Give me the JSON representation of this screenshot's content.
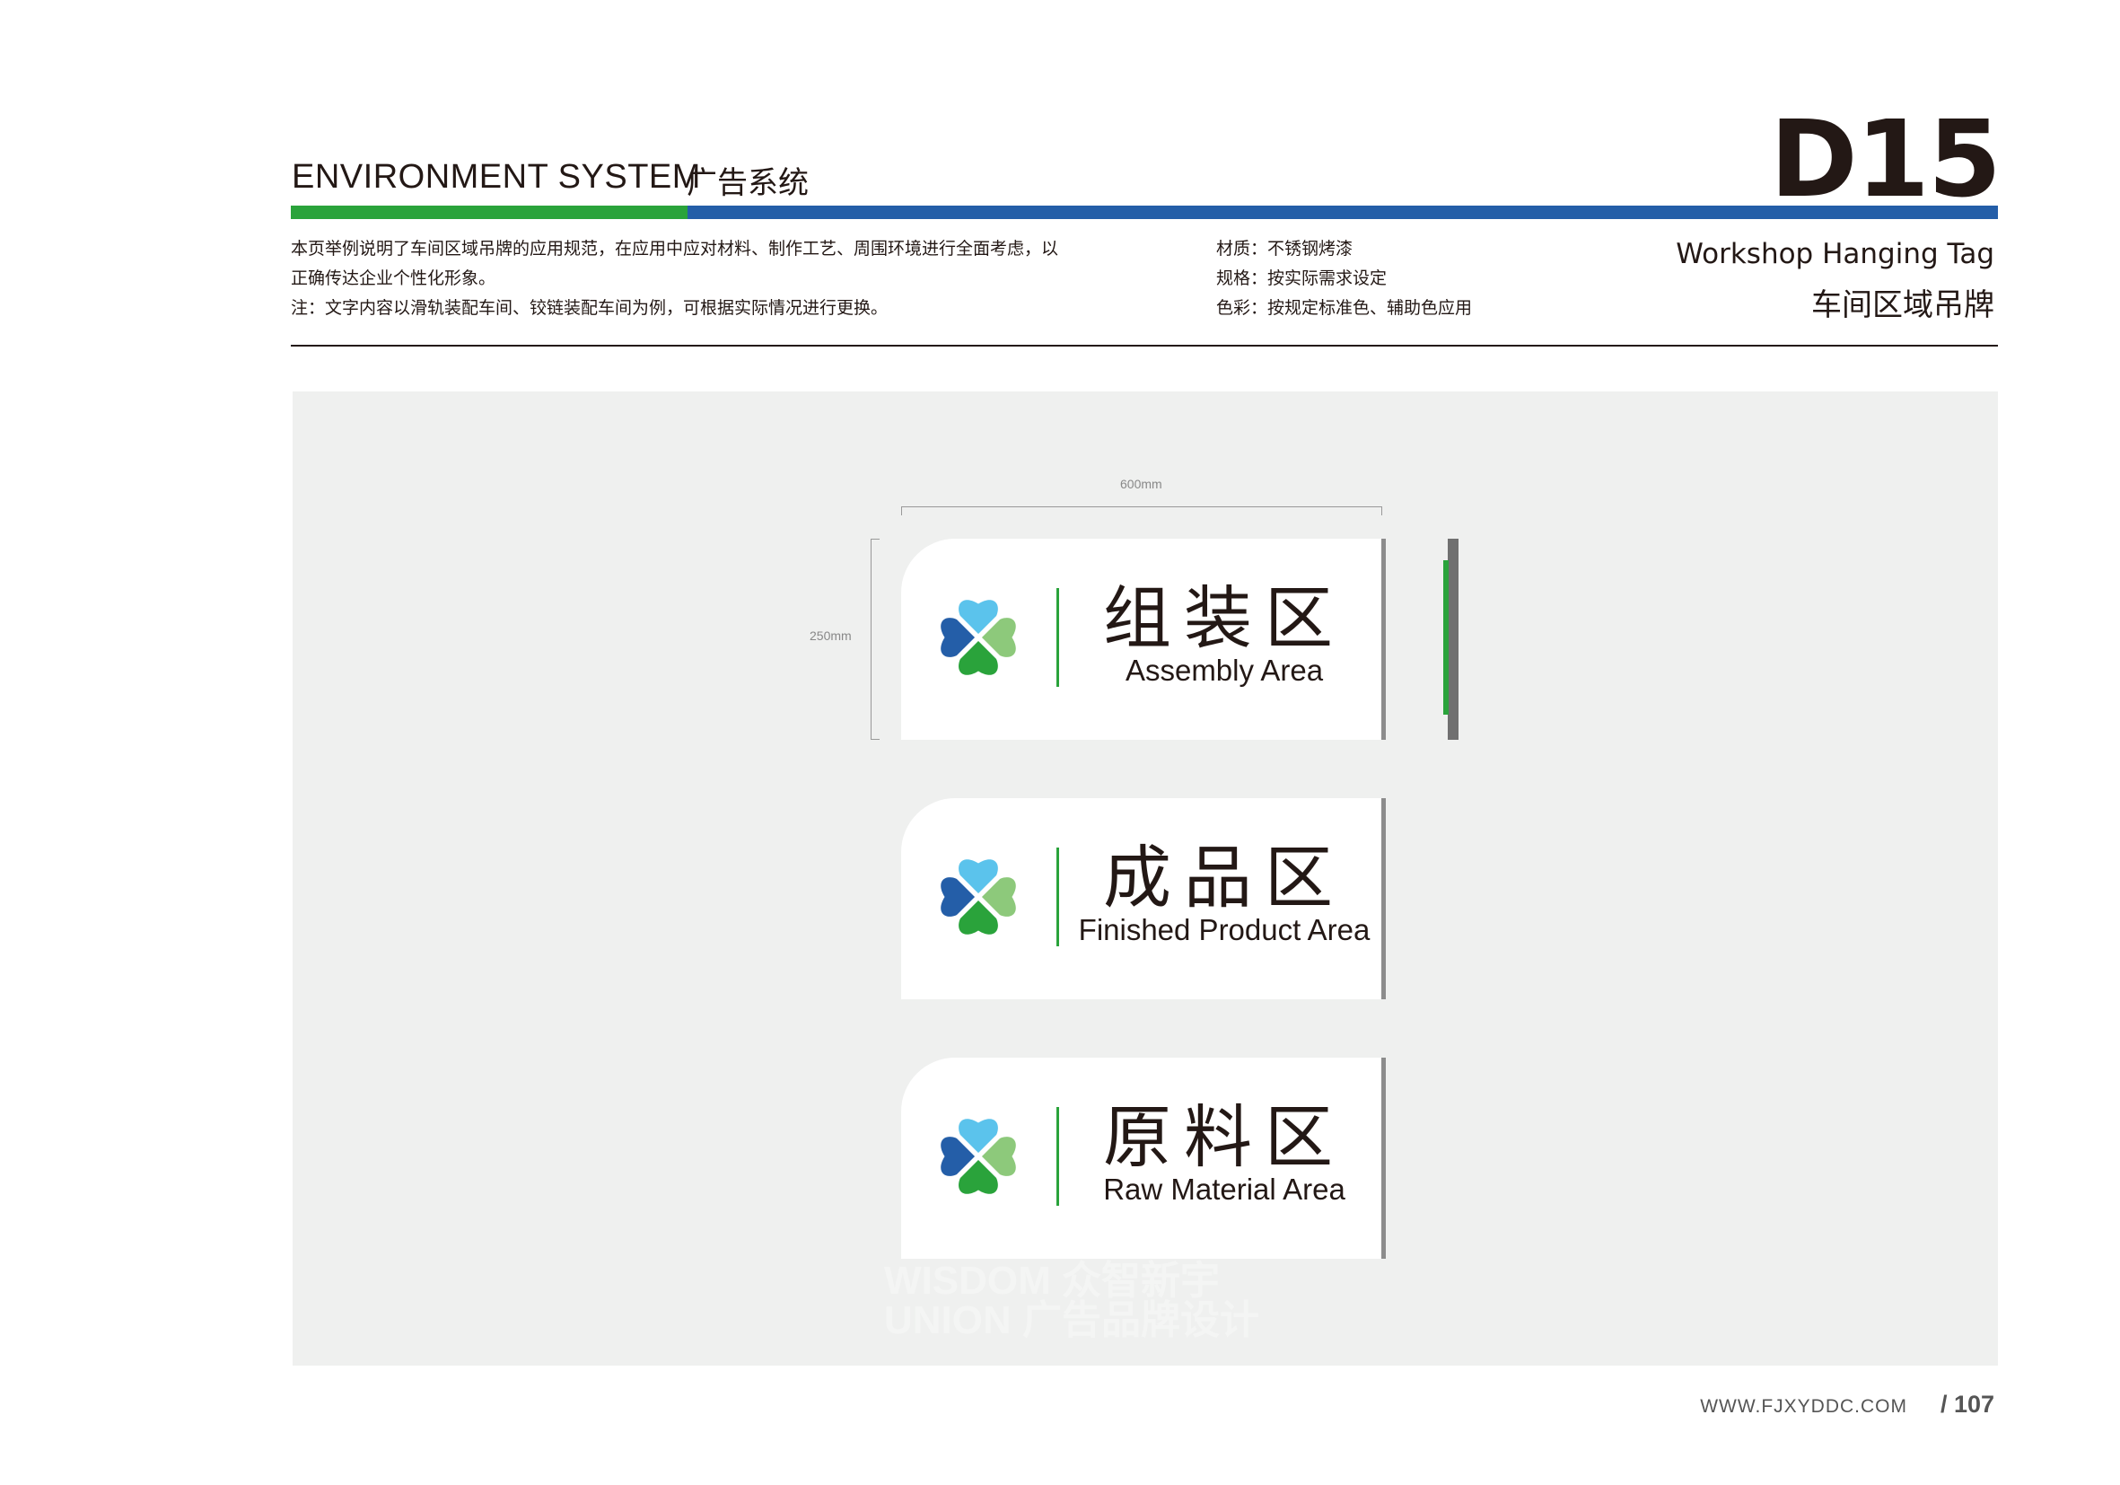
{
  "header": {
    "system_en": "ENVIRONMENT SYSTEM",
    "system_cn": "广告系统",
    "page_code": "D15"
  },
  "description": {
    "line1": "本页举例说明了车间区域吊牌的应用规范，在应用中应对材料、制作工艺、周围环境进行全面考虑，以",
    "line2": "正确传达企业个性化形象。",
    "line3": "注：文字内容以滑轨装配车间、铰链装配车间为例，可根据实际情况进行更换。"
  },
  "specs": {
    "material": "材质：不锈钢烤漆",
    "size": "规格：按实际需求设定",
    "color": "色彩：按规定标准色、辅助色应用"
  },
  "title": {
    "en": "Workshop Hanging Tag",
    "cn": "车间区域吊牌"
  },
  "dimensions": {
    "width": "600mm",
    "height": "250mm"
  },
  "signs": [
    {
      "cn": "组装区",
      "en": "Assembly Area"
    },
    {
      "cn": "成品区",
      "en": "Finished Product Area"
    },
    {
      "cn": "原料区",
      "en": "Raw Material Area"
    }
  ],
  "watermark": {
    "line1": "WISDOM 众智新宇",
    "line2": "UNION 广告品牌设计"
  },
  "footer": {
    "url": "WWW.FJXYDDC.COM",
    "page": "/ 107"
  },
  "colors": {
    "brand_green": "#2aa33b",
    "brand_blue": "#245ea8",
    "logo_light_blue": "#5bc3ec",
    "logo_light_green": "#8dc97b",
    "panel_bg": "#eff0ef",
    "side_gray": "#707070"
  },
  "icons": {
    "sign_logo": "four-leaf-clover-logo-icon"
  }
}
